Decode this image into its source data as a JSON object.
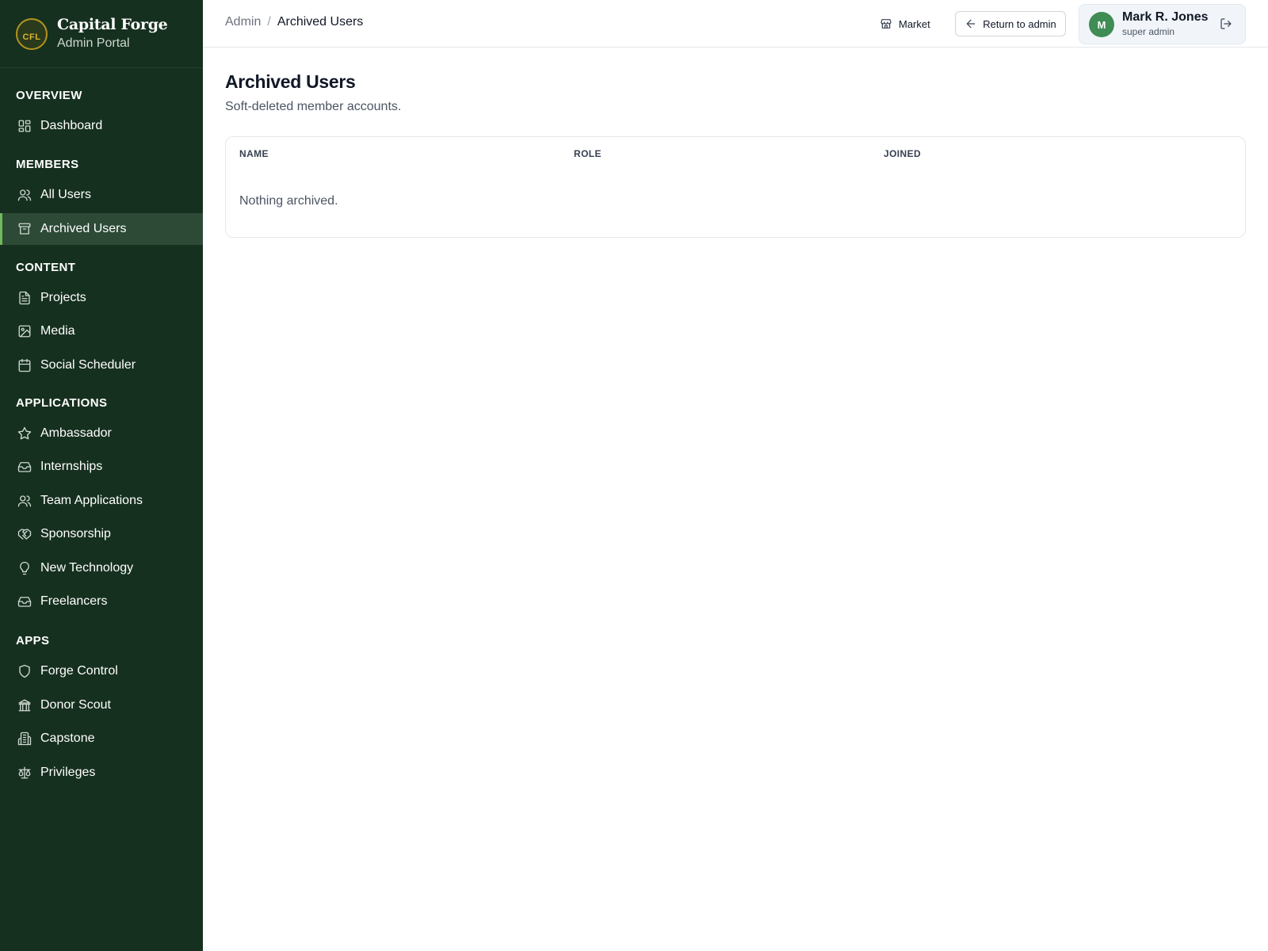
{
  "brand": {
    "name": "Capital Forge",
    "subtitle": "Admin Portal",
    "logo_text": "CFL"
  },
  "sidebar": {
    "sections": [
      {
        "title": "OVERVIEW",
        "items": [
          {
            "label": "Dashboard",
            "icon": "dashboard-icon"
          }
        ]
      },
      {
        "title": "MEMBERS",
        "items": [
          {
            "label": "All Users",
            "icon": "users-icon"
          },
          {
            "label": "Archived Users",
            "icon": "archive-icon",
            "active": true
          }
        ]
      },
      {
        "title": "CONTENT",
        "items": [
          {
            "label": "Projects",
            "icon": "document-icon"
          },
          {
            "label": "Media",
            "icon": "image-icon"
          },
          {
            "label": "Social Scheduler",
            "icon": "calendar-icon"
          }
        ]
      },
      {
        "title": "APPLICATIONS",
        "items": [
          {
            "label": "Ambassador",
            "icon": "star-icon"
          },
          {
            "label": "Internships",
            "icon": "inbox-icon"
          },
          {
            "label": "Team Applications",
            "icon": "users-icon"
          },
          {
            "label": "Sponsorship",
            "icon": "handshake-icon"
          },
          {
            "label": "New Technology",
            "icon": "lightbulb-icon"
          },
          {
            "label": "Freelancers",
            "icon": "inbox-icon"
          }
        ]
      },
      {
        "title": "APPS",
        "items": [
          {
            "label": "Forge Control",
            "icon": "shield-icon"
          },
          {
            "label": "Donor Scout",
            "icon": "bank-icon"
          },
          {
            "label": "Capstone",
            "icon": "building-icon"
          },
          {
            "label": "Privileges",
            "icon": "scale-icon"
          }
        ]
      }
    ]
  },
  "header": {
    "breadcrumb_parent": "Admin",
    "breadcrumb_separator": "/",
    "breadcrumb_current": "Archived Users",
    "market_label": "Market",
    "return_label": "Return to admin",
    "user": {
      "initial": "M",
      "name": "Mark R. Jones",
      "role": "super admin"
    }
  },
  "main": {
    "title": "Archived Users",
    "subtitle": "Soft-deleted member accounts.",
    "table": {
      "columns": [
        "NAME",
        "ROLE",
        "JOINED"
      ],
      "rows": [],
      "empty_message": "Nothing archived."
    }
  }
}
